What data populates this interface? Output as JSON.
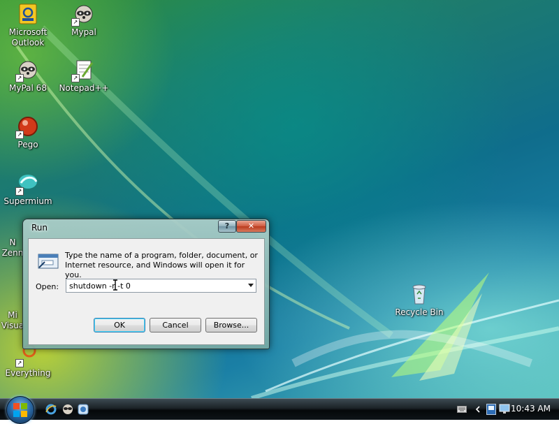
{
  "desktop": {
    "icons": [
      {
        "label": "Microsoft\nOutlook",
        "icon": "outlook-icon"
      },
      {
        "label": "Mypal",
        "icon": "raccoon-icon"
      },
      {
        "label": "MyPal 68",
        "icon": "raccoon-icon"
      },
      {
        "label": "Notepad++",
        "icon": "notepad-plus-plus-icon"
      },
      {
        "label": "Pego",
        "icon": "red-orb-icon"
      },
      {
        "label": "Supermium",
        "icon": "teal-swirl-icon"
      },
      {
        "label": "Everything",
        "icon": "magnifier-icon"
      },
      {
        "label": "Recycle Bin",
        "icon": "recycle-bin-icon"
      }
    ],
    "partial_icons": [
      {
        "label_a": "N",
        "label_b": "Zenn"
      },
      {
        "label_a": "Mi",
        "label_b": "Visua"
      }
    ]
  },
  "run_dialog": {
    "title": "Run",
    "help_label": "?",
    "close_label": "✕",
    "description": "Type the name of a program, folder, document, or Internet resource, and Windows will open it for you.",
    "open_label": "Open:",
    "open_value": "shutdown -r -t 0",
    "ok_label": "OK",
    "cancel_label": "Cancel",
    "browse_label": "Browse..."
  },
  "taskbar": {
    "quick_launch": [
      "internet-explorer-icon",
      "raccoon-icon",
      "media-icon"
    ],
    "tray_icons": [
      "keyboard-icon",
      "chevron-left-icon",
      "network-icon",
      "monitor-icon"
    ],
    "clock": "10:43 AM"
  }
}
